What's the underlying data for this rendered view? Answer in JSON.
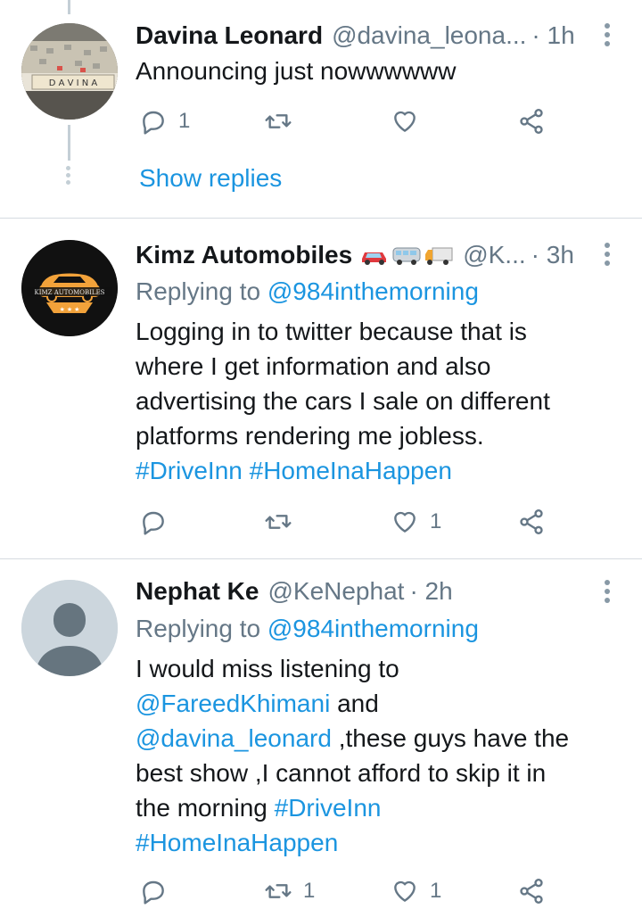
{
  "tweet1": {
    "name": "Davina Leonard",
    "handle": "@davina_leona...",
    "time": "· 1h",
    "text": "Announcing just nowwwwww",
    "reply_count": "1",
    "retweet_count": "",
    "like_count": "",
    "avatar_tiles": "D A V I N A",
    "show_replies": "Show replies"
  },
  "tweet2": {
    "name": "Kimz Automobiles",
    "handle": "@K...",
    "time": "· 3h",
    "replying_label": "Replying to",
    "replying_to": "@984inthemorning",
    "lines": [
      "Logging in to twitter because that is",
      "where I get information and also",
      "advertising the cars I sale on different",
      "platforms rendering me jobless."
    ],
    "hashtags": [
      "#DriveInn",
      "#HomeInaHappen"
    ],
    "avatar_logo_text": "KIMZ AUTOMOBILES",
    "reply_count": "",
    "retweet_count": "",
    "like_count": "1"
  },
  "tweet3": {
    "name": "Nephat Ke",
    "handle": "@KeNephat",
    "time": "· 2h",
    "replying_label": "Replying to",
    "replying_to": "@984inthemorning",
    "line1": "I would miss listening to",
    "mention1": "@FareedKhimani",
    "after_mention1": " and",
    "mention2": "@davina_leonard",
    "after_mention2": " ,these guys have the",
    "line4": "best show ,I cannot afford to skip it in",
    "line5_text": "the morning ",
    "hashtag1": "#DriveInn",
    "hashtag2": "#HomeInaHappen",
    "reply_count": "",
    "retweet_count": "1",
    "like_count": "1"
  },
  "colors": {
    "link": "#1b95e0",
    "muted": "#657786",
    "divider": "#d5dbe0",
    "thread": "#c4cfd6"
  },
  "icons": [
    "reply-icon",
    "retweet-icon",
    "like-icon",
    "share-icon",
    "more-icon"
  ]
}
